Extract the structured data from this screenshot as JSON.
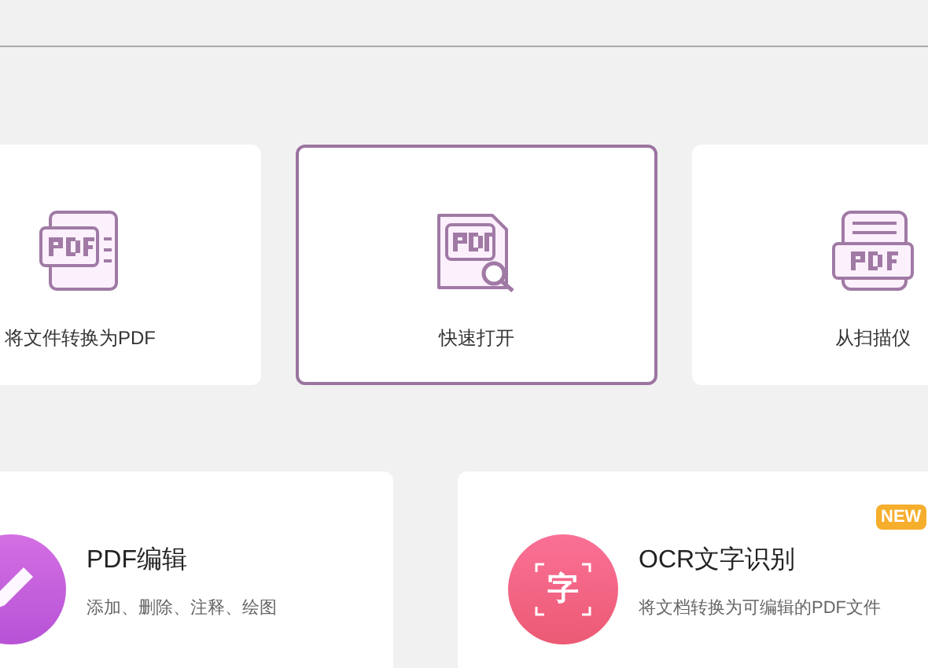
{
  "quick_actions": [
    {
      "kind": "convert",
      "label": "将文件转换为PDF",
      "selected": false
    },
    {
      "kind": "open",
      "label": "快速打开",
      "selected": true
    },
    {
      "kind": "scan",
      "label": "从扫描仪",
      "selected": false
    }
  ],
  "tools": [
    {
      "kind": "edit",
      "title": "PDF编辑",
      "description": "添加、删除、注释、绘图"
    },
    {
      "kind": "ocr",
      "title": "OCR文字识别",
      "description": "将文档转换为可编辑的PDF文件",
      "badge": "NEW",
      "icon_text": "字"
    }
  ]
}
